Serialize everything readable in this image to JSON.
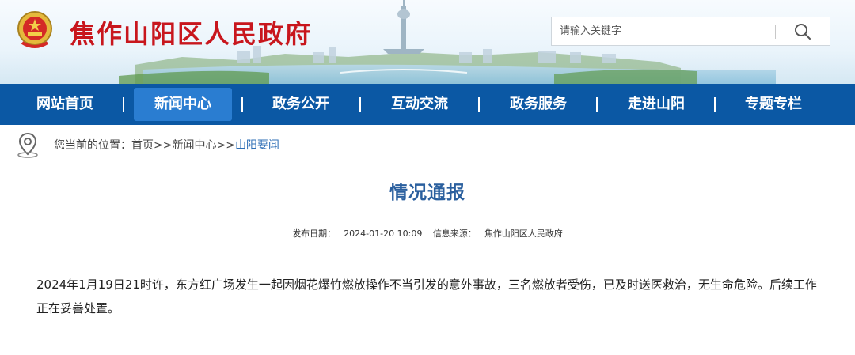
{
  "header": {
    "site_title": "焦作山阳区人民政府",
    "search_placeholder": "请输入关键字"
  },
  "nav": {
    "items": [
      {
        "label": "网站首页",
        "active": false
      },
      {
        "label": "新闻中心",
        "active": true
      },
      {
        "label": "政务公开",
        "active": false
      },
      {
        "label": "互动交流",
        "active": false
      },
      {
        "label": "政务服务",
        "active": false
      },
      {
        "label": "走进山阳",
        "active": false
      },
      {
        "label": "专题专栏",
        "active": false
      }
    ],
    "separator": "|"
  },
  "breadcrumb": {
    "prefix": "您当前的位置：",
    "home": "首页",
    "sep": ">>",
    "section": "新闻中心",
    "current": "山阳要闻"
  },
  "article": {
    "title": "情况通报",
    "publish_label": "发布日期：",
    "publish_date": "2024-01-20 10:09",
    "source_label": "信息来源：",
    "source": "焦作山阳区人民政府",
    "body": "2024年1月19日21时许，东方红广场发生一起因烟花爆竹燃放操作不当引发的意外事故，三名燃放者受伤，已及时送医救治，无生命危险。后续工作正在妥善处置。"
  },
  "colors": {
    "nav_bg": "#0b58a4",
    "nav_active": "#2a7dd1",
    "title_red": "#c8161d",
    "article_title": "#2a5f9e"
  },
  "icons": {
    "emblem": "national-emblem-icon",
    "search": "search-icon",
    "location": "location-pin-icon"
  }
}
